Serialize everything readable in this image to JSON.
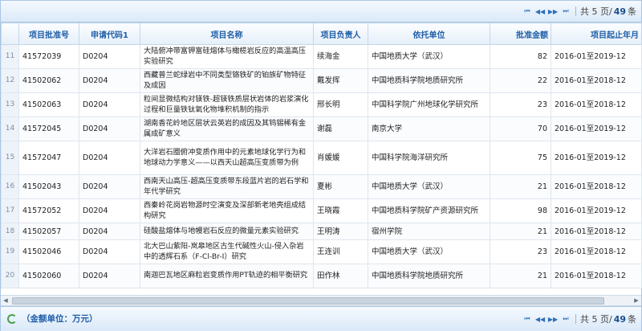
{
  "pager": {
    "first": "⏮",
    "prev": "◀◀",
    "next": "▶▶",
    "last": "⏭",
    "total_pages_text": "共 5 页/",
    "total_count": "49",
    "count_suffix": " 条"
  },
  "columns": [
    "",
    "项目批准号",
    "申请代码1",
    "项目名称",
    "项目负责人",
    "依托单位",
    "批准金额",
    "项目起止年月"
  ],
  "rows": [
    {
      "n": "11",
      "id": "41572039",
      "code": "D0204",
      "name": "大陆俯冲带富钾富硅熔体与橄榄岩反应的高温高压实验研究",
      "pi": "续海金",
      "org": "中国地质大学（武汉）",
      "amount": "82",
      "period": "2016-01至2019-12"
    },
    {
      "n": "12",
      "id": "41502062",
      "code": "D0204",
      "name": "西藏普兰蛇绿岩中不同类型铬铁矿的铂族矿物特征及成因",
      "pi": "戴发挥",
      "org": "中国地质科学院地质研究所",
      "amount": "22",
      "period": "2016-01至2018-12"
    },
    {
      "n": "13",
      "id": "41502063",
      "code": "D0204",
      "name": "粒间显微结构对镁铁-超镁铁质层状岩体的岩浆演化过程和巨量铁钛氧化物堆积机制的指示",
      "pi": "邢长明",
      "org": "中国科学院广州地球化学研究所",
      "amount": "23",
      "period": "2016-01至2018-12"
    },
    {
      "n": "14",
      "id": "41572045",
      "code": "D0204",
      "name": "湖南香花岭地区层状云英岩的成因及其钨锡稀有金属成矿意义",
      "pi": "谢磊",
      "org": "南京大学",
      "amount": "70",
      "period": "2016-01至2019-12"
    },
    {
      "n": "15",
      "id": "41572047",
      "code": "D0204",
      "name": "大洋岩石圈俯冲变质作用中的元素地球化学行为和地球动力学意义——以西天山超高压变质带为例",
      "pi": "肖媛媛",
      "org": "中国科学院海洋研究所",
      "amount": "75",
      "period": "2016-01至2019-12"
    },
    {
      "n": "16",
      "id": "41502043",
      "code": "D0204",
      "name": "西南天山高压-超高压变质带东段蓝片岩的岩石学和年代学研究",
      "pi": "夏彬",
      "org": "中国地质大学（武汉）",
      "amount": "21",
      "period": "2016-01至2018-12"
    },
    {
      "n": "17",
      "id": "41572052",
      "code": "D0204",
      "name": "西秦岭花岗岩物源时空演变及深部新老地壳组成结构研究",
      "pi": "王晓霞",
      "org": "中国地质科学院矿产资源研究所",
      "amount": "98",
      "period": "2016-01至2019-12"
    },
    {
      "n": "18",
      "id": "41502057",
      "code": "D0204",
      "name": "硅酸盐熔体与地幔岩石反应的微量元素实验研究",
      "pi": "王明涛",
      "org": "宿州学院",
      "amount": "21",
      "period": "2016-01至2018-12"
    },
    {
      "n": "19",
      "id": "41502046",
      "code": "D0204",
      "name": "北大巴山紫阳-岚皋地区古生代碱性火山-侵入杂岩中的透辉石系（F-Cl-Br-I）研究",
      "pi": "王连训",
      "org": "中国地质大学（武汉）",
      "amount": "23",
      "period": "2016-01至2018-12"
    },
    {
      "n": "20",
      "id": "41502060",
      "code": "D0204",
      "name": "南迦巴瓦地区麻粒岩变质作用PT轨迹的相平衡研究",
      "pi": "田作林",
      "org": "中国地质科学院地质研究所",
      "amount": "21",
      "period": "2016-01至2018-12"
    }
  ],
  "footer": {
    "unit_label": "（金额单位：万元）"
  },
  "colors": {
    "header_text": "#1f5fa8",
    "accent": "#2d6fb8",
    "refresh": "#4aa04a"
  }
}
